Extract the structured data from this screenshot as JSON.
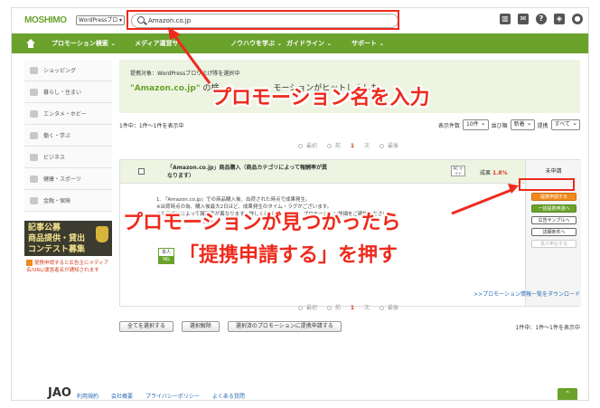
{
  "header": {
    "logo": "MOSHIMO",
    "site_select": "WordPressブロ",
    "search_value": "Amazon.co.jp",
    "icons": [
      "chart-icon",
      "mail-icon",
      "help-icon",
      "shield-icon",
      "user-icon"
    ]
  },
  "nav": {
    "items": [
      "プロモーション検索",
      "メディア運営サ",
      "ノウハウを学ぶ",
      "ガイドライン",
      "サポート"
    ]
  },
  "sidebar": {
    "items": [
      "ショッピング",
      "暮らし・住まい",
      "エンタメ・ホビー",
      "働く・学ぶ",
      "ビジネス",
      "健康・スポーツ",
      "金融・保険"
    ],
    "banner_lines": [
      "記事公募",
      "商品提供・貸出",
      "コンテスト募集"
    ],
    "note": "提携申請すると広告主にメディア名/URL/運営者名が通知されます"
  },
  "main": {
    "target_label": "提携対象：WordPressブロ",
    "target_suffix": "り上げ隊を選択中",
    "title_quoted": "\"Amazon.co.jp\"",
    "title_rest": "の検",
    "title_tail": "モーションがヒットしました",
    "result_count": "1件中：1件～1件を表示中",
    "sort_label_count": "表示件数",
    "sort_count_value": "10件",
    "sort_label_order": "並び順",
    "sort_order_value": "新着",
    "sort_label_partner": "提携",
    "sort_partner_value": "すべて",
    "pager": {
      "first": "最初",
      "prev": "前",
      "current": "1",
      "next": "次",
      "last": "最後"
    },
    "row": {
      "title": "「Amazon.co.jp」商品購入（商品カテゴリによって報酬率が異なります）",
      "device": "PC サイト",
      "reward_label": "成果",
      "reward_value": "1.8%",
      "status": "未申請",
      "desc_lines": [
        "1. 『Amazon.co.jp』での商品購入後、出荷された時点で成果発生。",
        "※出荷時点の為、購入後最大2日ほど、成果発生のタイム・ラグがございます。",
        "※カテゴリによって報酬率が異なります。詳しくは以下のリンク、プロモーション詳細をご確認ください。"
      ],
      "small_reward": "1.8%",
      "honin": "本人",
      "ng": "NG"
    },
    "actions": {
      "apply": "提携申請する",
      "bulk_apply": "一括提携申請へ",
      "ad_sample": "広告サンプルへ",
      "detail": "詳細条件へ",
      "self_apply": "本人申込する"
    },
    "download_link": ">>プロモーション情報一覧をダウンロード",
    "bottom_buttons": [
      "全てを選択する",
      "選択解除",
      "選択済のプロモーションに提携申請する"
    ],
    "bottom_count": "1件中：1件～1件を表示中"
  },
  "footer": {
    "logo": "JAO",
    "links": [
      "利用規約",
      "会社概要",
      "プライバシーポリシー",
      "よくある質問"
    ]
  },
  "annotations": {
    "promo_name": "プロモーション名を入力",
    "found_line1": "プロモーションが見つかったら",
    "found_line2": "「提携申請する」を押す",
    "color": "#ee2a1c"
  }
}
